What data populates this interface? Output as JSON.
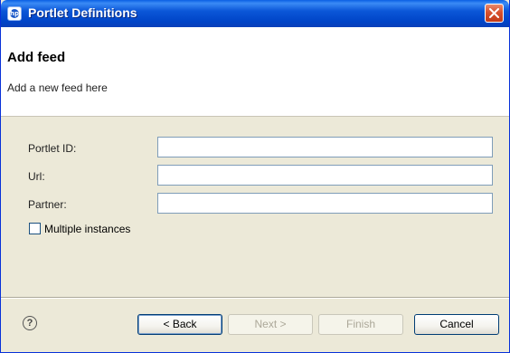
{
  "window": {
    "title": "Portlet Definitions",
    "icon": "hp-logo-icon"
  },
  "banner": {
    "title": "Add feed",
    "description": "Add a new feed here"
  },
  "form": {
    "fields": [
      {
        "label": "Portlet ID:",
        "value": "",
        "placeholder": ""
      },
      {
        "label": "Url:",
        "value": "",
        "placeholder": ""
      },
      {
        "label": "Partner:",
        "value": "",
        "placeholder": ""
      }
    ],
    "multiple_instances": {
      "label": "Multiple instances",
      "checked": false
    }
  },
  "footer": {
    "help_icon": "?",
    "back_label": "< Back",
    "next_label": "Next >",
    "finish_label": "Finish",
    "cancel_label": "Cancel"
  },
  "colors": {
    "titlebar": "#0054e3",
    "close_button": "#d8512e",
    "dialog_bg": "#ece9d8",
    "input_border": "#7f9db9"
  }
}
